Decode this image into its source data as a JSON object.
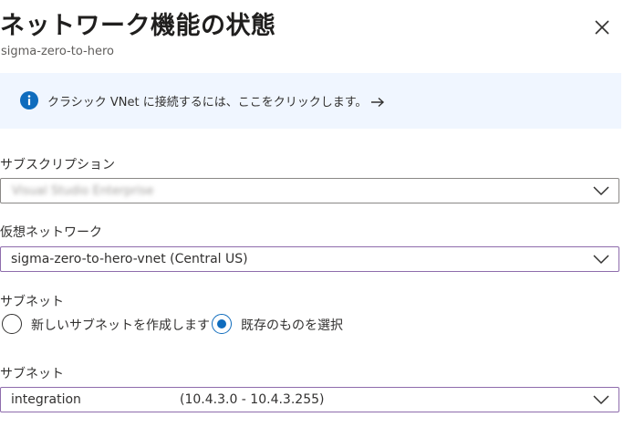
{
  "header": {
    "title": "ネットワーク機能の状態",
    "subtitle": "sigma-zero-to-hero"
  },
  "info_banner": {
    "text": "クラシック VNet に接続するには、ここをクリックします。",
    "icon": "info-icon",
    "arrow_icon": "arrow-right-icon"
  },
  "subscription": {
    "label": "サブスクリプション",
    "value_blurred": "Visual Studio Enterprise"
  },
  "virtual_network": {
    "label": "仮想ネットワーク",
    "value": "sigma-zero-to-hero-vnet (Central US)"
  },
  "subnet_mode": {
    "label": "サブネット",
    "options": [
      {
        "label": "新しいサブネットを作成します",
        "selected": false
      },
      {
        "label": "既存のものを選択",
        "selected": true
      }
    ]
  },
  "subnet": {
    "label": "サブネット",
    "name": "integration",
    "range": "(10.4.3.0 - 10.4.3.255)"
  },
  "colors": {
    "info_background": "#f0f6ff",
    "info_icon": "#0f6cbd",
    "focus_border": "#8e6cac",
    "radio_selected": "#0f6cbd"
  }
}
